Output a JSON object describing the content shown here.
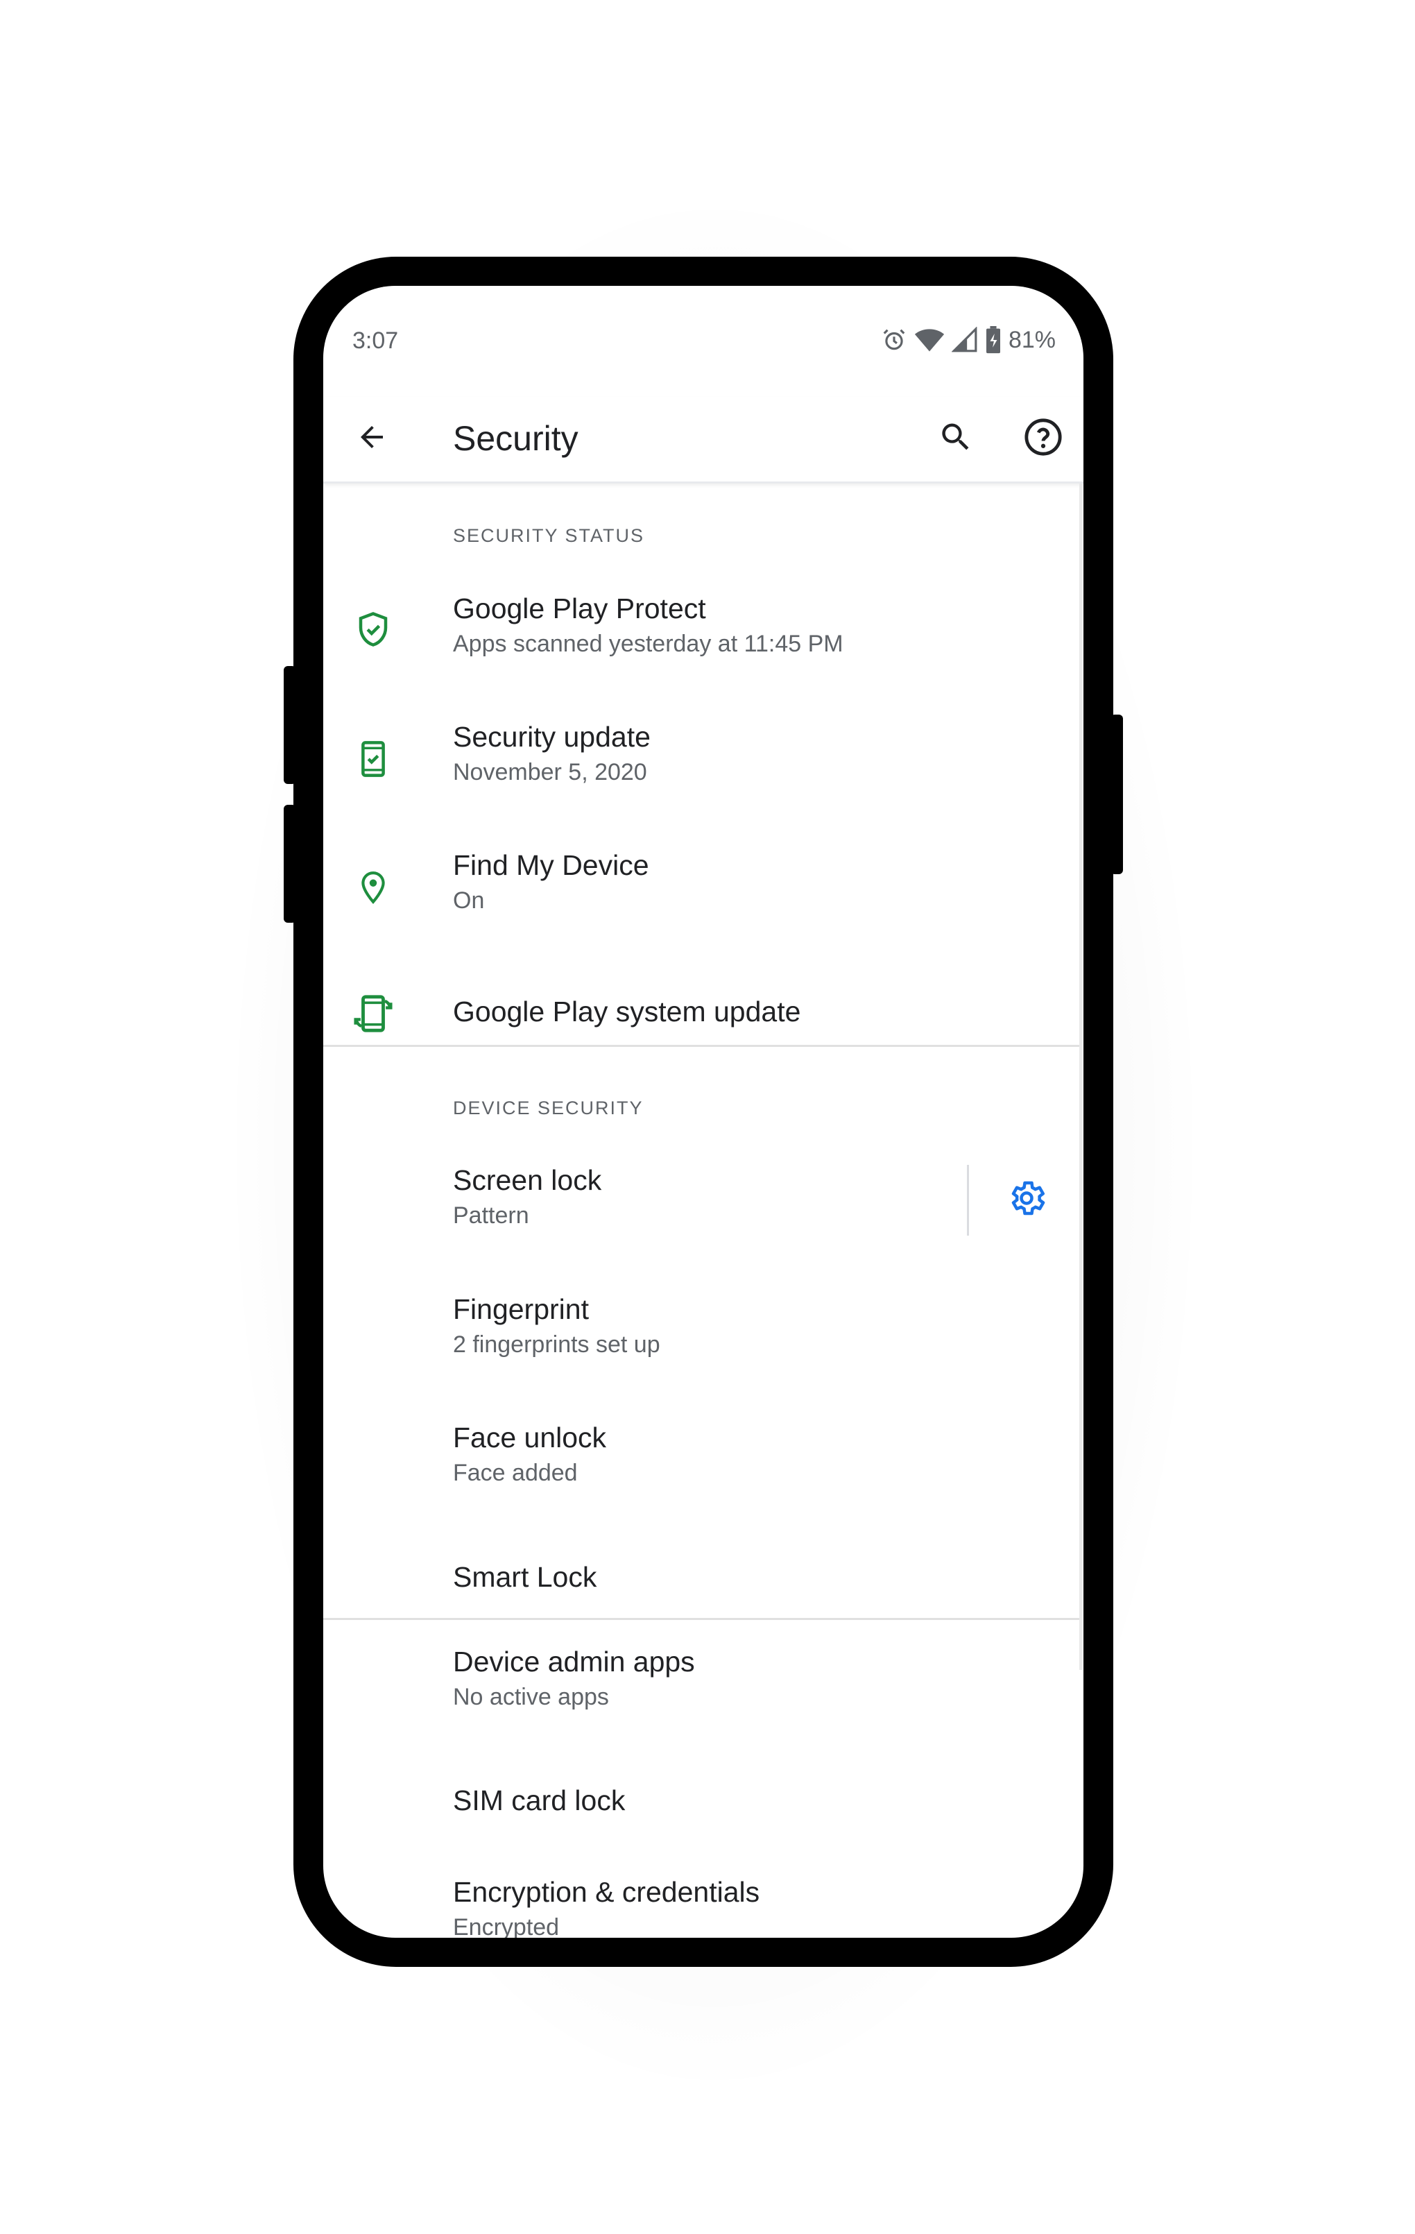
{
  "status_bar": {
    "time": "3:07",
    "battery_percent": "81%",
    "icons": [
      "alarm-icon",
      "wifi-icon",
      "cell-signal-icon",
      "battery-charging-icon"
    ]
  },
  "app_bar": {
    "title": "Security",
    "actions": [
      "back-arrow-icon",
      "search-icon",
      "help-icon"
    ]
  },
  "sections": {
    "security_status": {
      "header": "SECURITY STATUS",
      "items": [
        {
          "title": "Google Play Protect",
          "subtitle": "Apps scanned yesterday at 11:45 PM",
          "icon": "shield-check-icon"
        },
        {
          "title": "Security update",
          "subtitle": "November 5, 2020",
          "icon": "phone-check-icon"
        },
        {
          "title": "Find My Device",
          "subtitle": "On",
          "icon": "location-pin-icon"
        },
        {
          "title": "Google Play system update",
          "icon": "phone-update-icon"
        }
      ]
    },
    "device_security": {
      "header": "DEVICE SECURITY",
      "items": [
        {
          "title": "Screen lock",
          "subtitle": "Pattern",
          "action_icon": "gear-icon"
        },
        {
          "title": "Fingerprint",
          "subtitle": "2 fingerprints set up"
        },
        {
          "title": "Face unlock",
          "subtitle": "Face added"
        },
        {
          "title": "Smart Lock"
        }
      ]
    },
    "other": {
      "items": [
        {
          "title": "Device admin apps",
          "subtitle": "No active apps"
        },
        {
          "title": "SIM card lock"
        },
        {
          "title": "Encryption & credentials",
          "subtitle": "Encrypted"
        }
      ]
    }
  },
  "colors": {
    "accent_green": "#1e8e3e",
    "accent_blue": "#1a73e8",
    "text_primary": "#202124",
    "text_secondary": "#5f6368"
  }
}
